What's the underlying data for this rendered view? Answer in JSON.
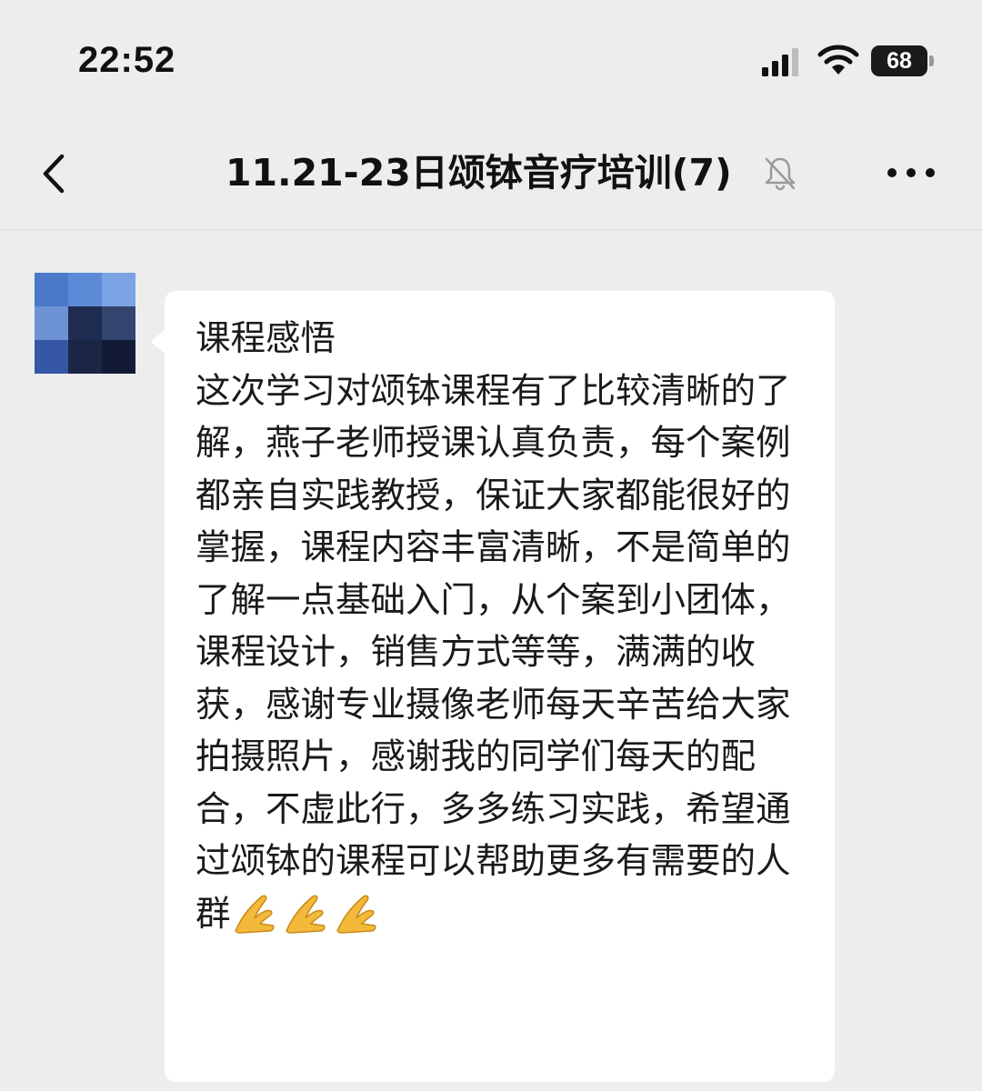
{
  "status_bar": {
    "time": "22:52",
    "battery": "68"
  },
  "nav": {
    "title": "11.21-23日颂钵音疗培训(7)",
    "back_icon": "chevron-left-icon",
    "mute_icon": "bell-off-icon",
    "more_icon": "more-dots-icon"
  },
  "message": {
    "sender_avatar": "blurred-avatar",
    "text": "课程感悟\n这次学习对颂钵课程有了比较清晰的了解，燕子老师授课认真负责，每个案例都亲自实践教授，保证大家都能很好的掌握，课程内容丰富清晰，不是简单的了解一点基础入门，从个案到小团体，课程设计，销售方式等等，满满的收获，感谢专业摄像老师每天辛苦给大家拍摄照片，感谢我的同学们每天的配合，不虚此行，多多练习实践，希望通过颂钵的课程可以帮助更多有需要的人群",
    "emoji": [
      "folded-hands-emoji",
      "folded-hands-emoji",
      "folded-hands-emoji"
    ]
  },
  "colors": {
    "background": "#ededed",
    "bubble": "#ffffff",
    "text": "#1a1a1a"
  }
}
